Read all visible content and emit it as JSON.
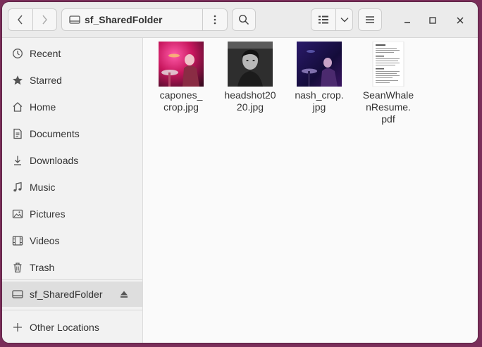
{
  "window": {
    "path_label": "sf_SharedFolder"
  },
  "sidebar": {
    "items": [
      {
        "label": "Recent",
        "icon": "clock-icon"
      },
      {
        "label": "Starred",
        "icon": "star-icon"
      },
      {
        "label": "Home",
        "icon": "home-icon"
      },
      {
        "label": "Documents",
        "icon": "document-icon"
      },
      {
        "label": "Downloads",
        "icon": "download-icon"
      },
      {
        "label": "Music",
        "icon": "music-icon"
      },
      {
        "label": "Pictures",
        "icon": "picture-icon"
      },
      {
        "label": "Videos",
        "icon": "video-icon"
      },
      {
        "label": "Trash",
        "icon": "trash-icon"
      },
      {
        "label": "sf_SharedFolder",
        "icon": "drive-icon"
      },
      {
        "label": "Other Locations",
        "icon": "plus-icon"
      }
    ]
  },
  "files": [
    {
      "name": "capones_\ncrop.jpg",
      "type": "image"
    },
    {
      "name": "headshot20\n20.jpg",
      "type": "image"
    },
    {
      "name": "nash_crop.\njpg",
      "type": "image"
    },
    {
      "name": "SeanWhale\nnResume.\npdf",
      "type": "pdf"
    }
  ],
  "colors": {
    "desktop": "#7a2e5a",
    "active_item": "#dedede"
  }
}
